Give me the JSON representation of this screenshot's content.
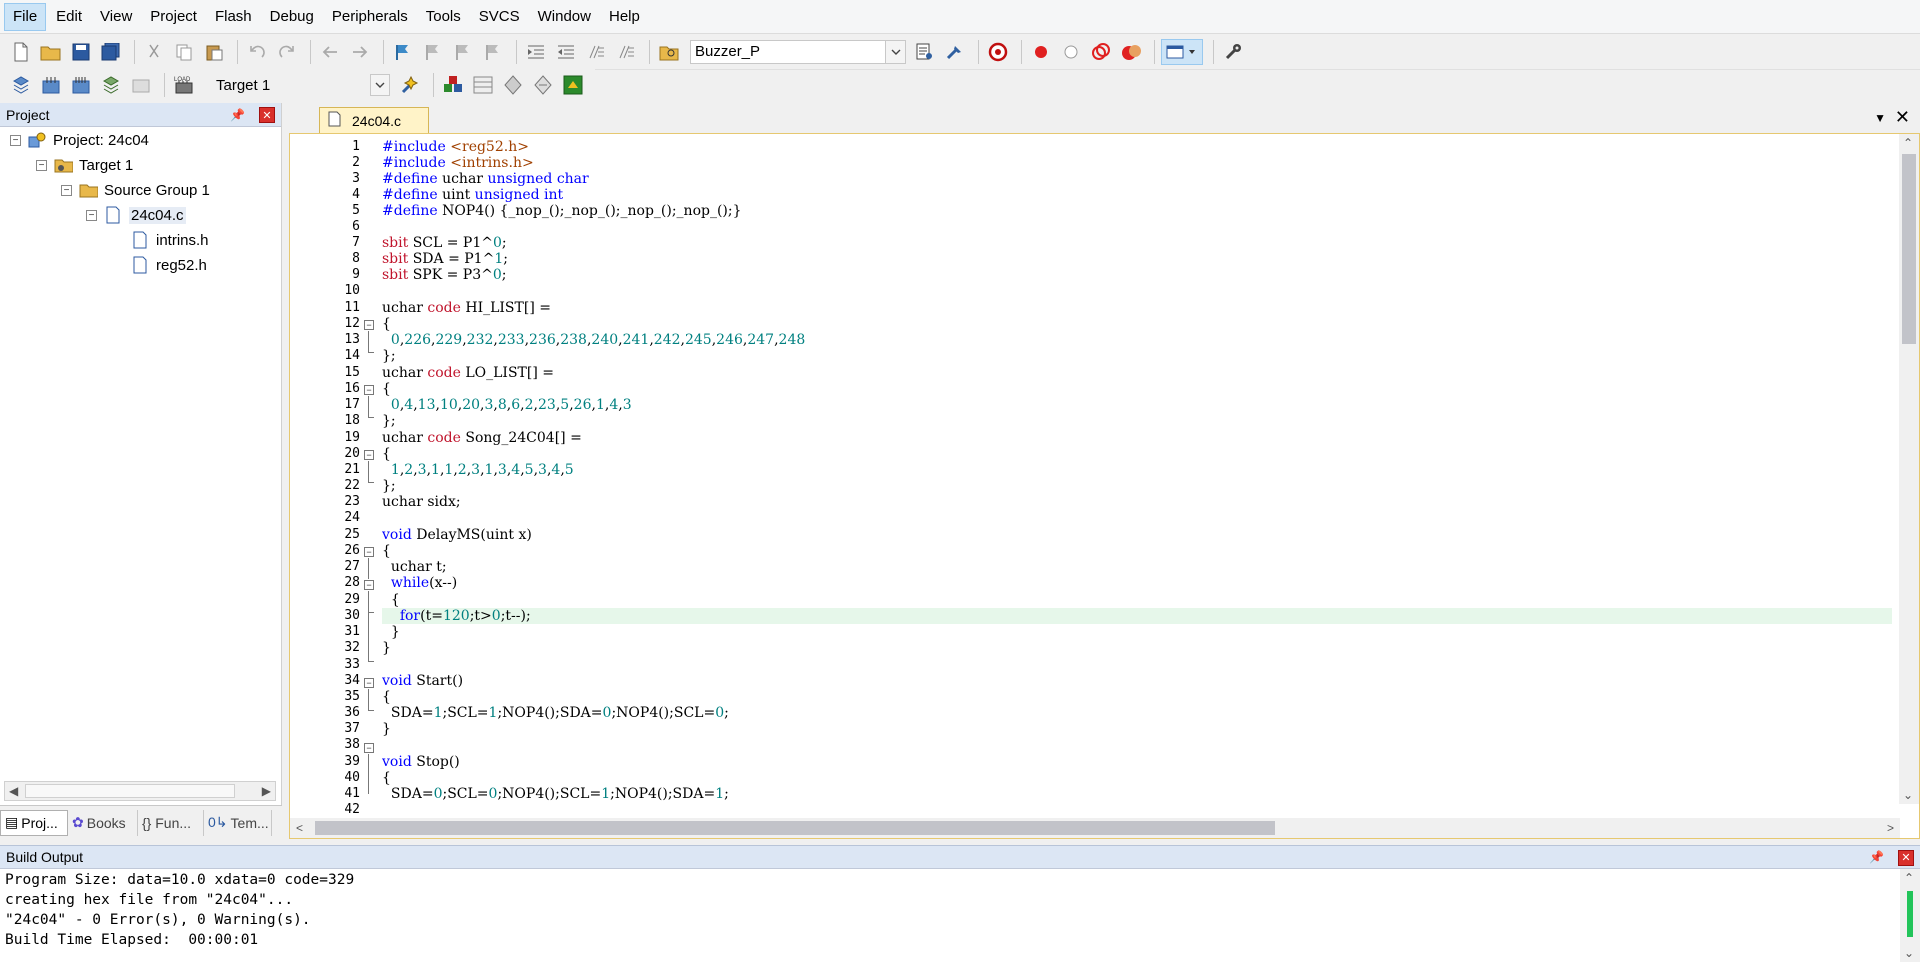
{
  "menu": [
    "File",
    "Edit",
    "View",
    "Project",
    "Flash",
    "Debug",
    "Peripherals",
    "Tools",
    "SVCS",
    "Window",
    "Help"
  ],
  "toolbar1": {
    "find_combo_value": "Buzzer_P"
  },
  "toolbar2": {
    "target_combo_value": "Target 1",
    "load_label": "LOAD"
  },
  "project": {
    "title": "Project",
    "root": "Project: 24c04",
    "target": "Target 1",
    "group": "Source Group 1",
    "file": "24c04.c",
    "includes": [
      "intrins.h",
      "reg52.h"
    ],
    "tabs": [
      "Proj...",
      "Books",
      "{} Fun...",
      "Tem..."
    ]
  },
  "editor": {
    "tab_label": "24c04.c",
    "line_numbers": [
      "1",
      "2",
      "3",
      "4",
      "5",
      "6",
      "7",
      "8",
      "9",
      "10",
      "11",
      "12",
      "13",
      "14",
      "15",
      "16",
      "17",
      "18",
      "19",
      "20",
      "21",
      "22",
      "23",
      "24",
      "25",
      "26",
      "27",
      "28",
      "29",
      "30",
      "31",
      "32",
      "33",
      "34",
      "35",
      "36",
      "37",
      "38",
      "39",
      "40",
      "41",
      "42"
    ]
  },
  "build": {
    "title": "Build Output",
    "lines": [
      "Program Size: data=10.0 xdata=0 code=329",
      "creating hex file from \"24c04\"...",
      "\"24c04\" - 0 Error(s), 0 Warning(s).",
      "Build Time Elapsed:  00:00:01"
    ]
  },
  "colors": {
    "keyword": "#0000ff",
    "code_keyword": "#c0142c",
    "number": "#008080",
    "highlight_line": "#e6f7ea",
    "active_tab": "#fff3c8",
    "pane_header": "#dce6f4"
  }
}
